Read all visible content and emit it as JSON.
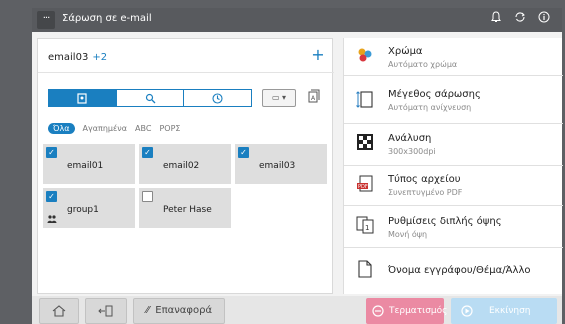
{
  "topbar": {
    "menu_label": "···",
    "title": "Σάρωση σε e-mail",
    "icons": [
      "bell-icon",
      "refresh-icon",
      "info-icon"
    ]
  },
  "address": {
    "current": "email03",
    "more": "+2",
    "add_symbol": "+"
  },
  "search_tabs": [
    "address-book-icon",
    "search-icon",
    "history-icon"
  ],
  "view_dropdown": "▭ ▾",
  "filters": [
    "Όλα",
    "Αγαπημένα",
    "ABC",
    "ΡΟΡΣ"
  ],
  "tiles": [
    {
      "label": "email01",
      "checked": true
    },
    {
      "label": "email02",
      "checked": true
    },
    {
      "label": "email03",
      "checked": true
    },
    {
      "label": "group1",
      "checked": true,
      "group": true
    },
    {
      "label": "Peter Hase",
      "checked": false
    }
  ],
  "settings": [
    {
      "title": "Χρώμα",
      "value": "Αυτόματο χρώμα",
      "icon": "color-icon"
    },
    {
      "title": "Μέγεθος σάρωσης",
      "value": "Αυτόματη ανίχνευση",
      "icon": "scan-size-icon"
    },
    {
      "title": "Ανάλυση",
      "value": "300x300dpi",
      "icon": "resolution-icon"
    },
    {
      "title": "Τύπος αρχείου",
      "value": "Συνεπτυγμένο PDF",
      "icon": "pdf-icon"
    },
    {
      "title": "Ρυθμίσεις διπλής όψης",
      "value": "Μονή όψη",
      "icon": "duplex-icon"
    },
    {
      "title": "Όνομα εγγράφου/Θέμα/Άλλο",
      "value": "",
      "icon": "document-icon"
    }
  ],
  "bottom": {
    "home_icon": "home-icon",
    "back_icon": "back-icon",
    "reset_label": "Επαναφορά",
    "stop_label": "Τερματισμός",
    "start_label": "Εκκίνηση"
  },
  "colors": {
    "accent": "#1a7fc0",
    "stop": "#eb8aa3",
    "start": "#b9dcf3",
    "topbar": "#585a5e"
  }
}
